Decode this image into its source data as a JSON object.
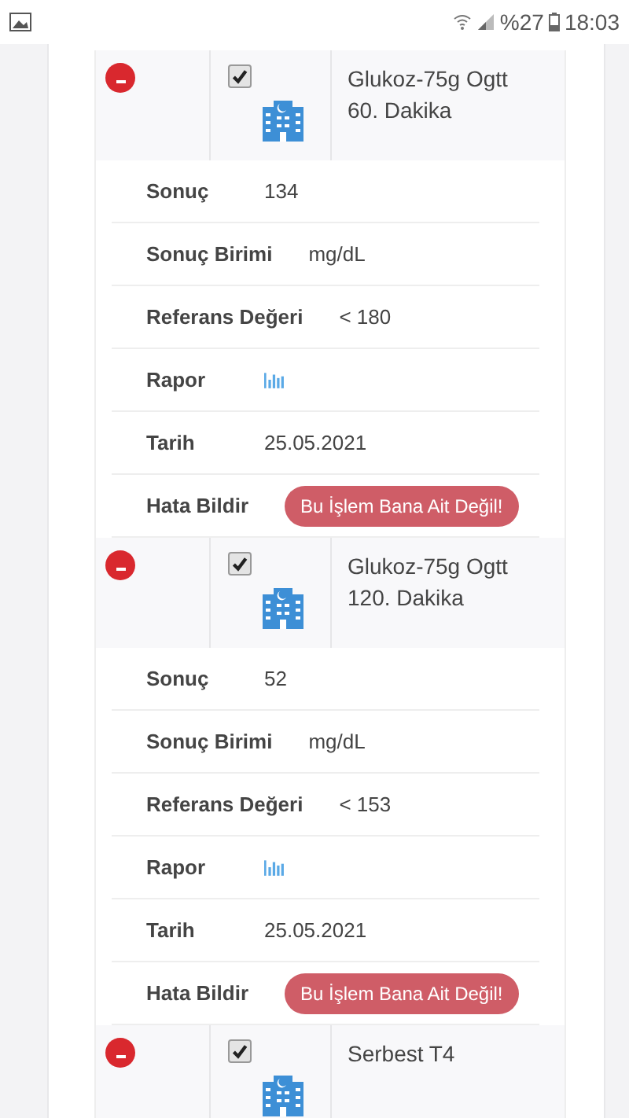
{
  "status_bar": {
    "battery": "%27",
    "time": "18:03"
  },
  "records": [
    {
      "checked": true,
      "name": "Glukoz-75g Ogtt 60. Dakika",
      "details": [
        {
          "kind": "text",
          "label": "Sonuç",
          "value": "134"
        },
        {
          "kind": "text",
          "label": "Sonuç Birimi",
          "value": "mg/dL"
        },
        {
          "kind": "text",
          "label": "Referans Değeri",
          "value": "< 180"
        },
        {
          "kind": "report",
          "label": "Rapor"
        },
        {
          "kind": "text",
          "label": "Tarih",
          "value": "25.05.2021"
        },
        {
          "kind": "button",
          "label": "Hata Bildir",
          "value": "Bu İşlem Bana Ait Değil!"
        }
      ]
    },
    {
      "checked": true,
      "name": "Glukoz-75g Ogtt 120. Dakika",
      "details": [
        {
          "kind": "text",
          "label": "Sonuç",
          "value": "52"
        },
        {
          "kind": "text",
          "label": "Sonuç Birimi",
          "value": "mg/dL"
        },
        {
          "kind": "text",
          "label": "Referans Değeri",
          "value": "< 153"
        },
        {
          "kind": "report",
          "label": "Rapor"
        },
        {
          "kind": "text",
          "label": "Tarih",
          "value": "25.05.2021"
        },
        {
          "kind": "button",
          "label": "Hata Bildir",
          "value": "Bu İşlem Bana Ait Değil!"
        }
      ]
    },
    {
      "checked": true,
      "name": "Serbest T4"
    }
  ]
}
